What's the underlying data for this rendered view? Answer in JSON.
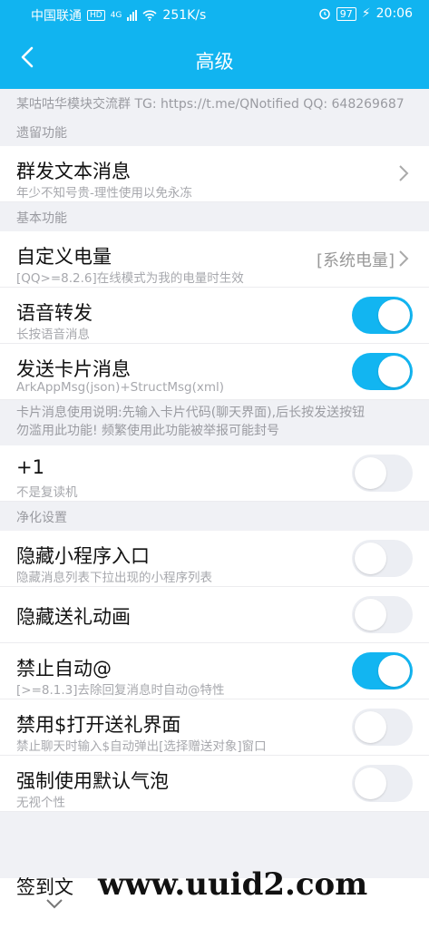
{
  "status_bar": {
    "carrier": "中国联通",
    "hd": "HD",
    "network": "4G",
    "speed": "251K/s",
    "battery": "97",
    "time": "20:06"
  },
  "header": {
    "title": "高级",
    "back_icon": "chevron-left-icon"
  },
  "info_text": "某咕咕华模块交流群 TG: https://t.me/QNotified QQ: 648269687",
  "sections": {
    "legacy": "遗留功能",
    "basic": "基本功能",
    "purify": "净化设置"
  },
  "items": {
    "mass_text": {
      "title": "群发文本消息",
      "sub": "年少不知号贵-理性使用以免永冻"
    },
    "battery": {
      "title": "自定义电量",
      "sub": "[QQ>=8.2.6]在线模式为我的电量时生效",
      "value": "[系统电量]"
    },
    "voice_forward": {
      "title": "语音转发",
      "sub": "长按语音消息",
      "on": true
    },
    "send_card": {
      "title": "发送卡片消息",
      "sub": "ArkAppMsg(json)+StructMsg(xml)",
      "on": true
    },
    "plus_one": {
      "title": "+1",
      "sub": "不是复读机",
      "on": false
    },
    "hide_mini": {
      "title": "隐藏小程序入口",
      "sub": "隐藏消息列表下拉出现的小程序列表",
      "on": false
    },
    "hide_gift_anim": {
      "title": "隐藏送礼动画",
      "on": false
    },
    "no_auto_at": {
      "title": "禁止自动@",
      "sub": "[>=8.1.3]去除回复消息时自动@特性",
      "on": true
    },
    "no_gift_ui": {
      "title": "禁用$打开送礼界面",
      "sub": "禁止聊天时输入$自动弹出[选择赠送对象]窗口",
      "on": false
    },
    "default_bubble": {
      "title": "强制使用默认气泡",
      "sub": "无视个性",
      "on": false
    },
    "bottom_partial": {
      "title": "签到文"
    }
  },
  "card_note": {
    "line1": "卡片消息使用说明:先输入卡片代码(聊天界面),后长按发送按钮",
    "line2": "勿滥用此功能! 频繁使用此功能被举报可能封号"
  },
  "watermark": "www.uuid2.com",
  "colors": {
    "accent": "#12b5f1",
    "header": "#11b4f0"
  }
}
